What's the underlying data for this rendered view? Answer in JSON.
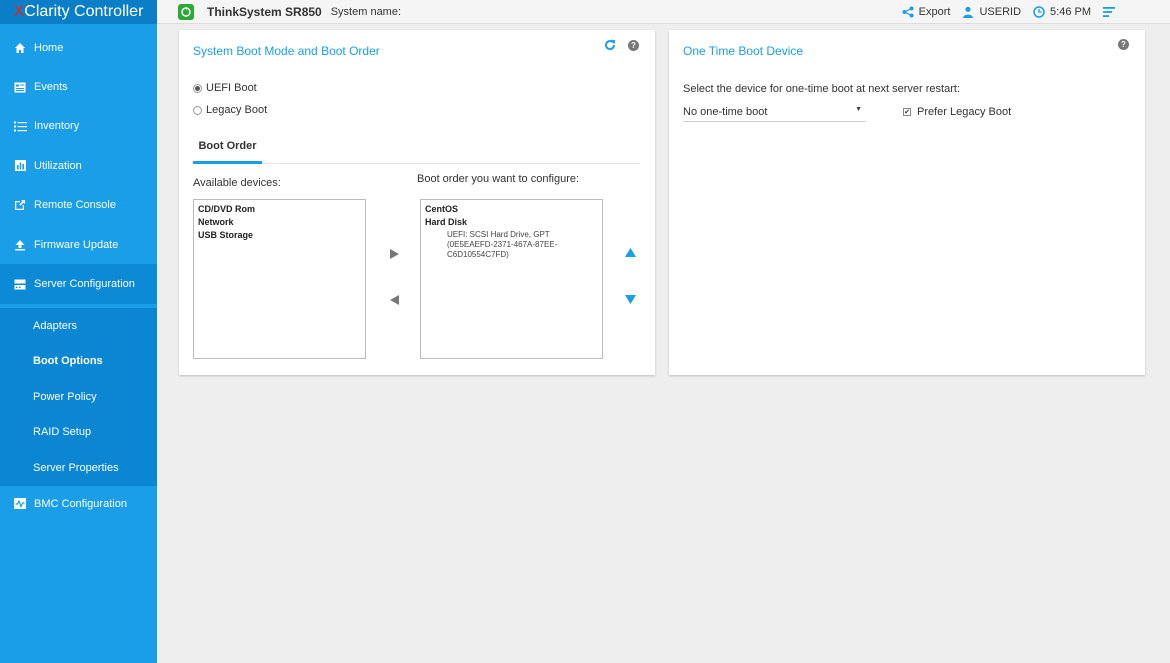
{
  "brand": {
    "prefix": "X",
    "suffix": "Clarity Controller"
  },
  "header": {
    "model": "ThinkSystem SR850",
    "system_name_label": "System name:",
    "export_label": "Export",
    "user": "USERID",
    "time": "5:46 PM"
  },
  "sidebar": {
    "items": [
      {
        "label": "Home",
        "icon": "home-icon"
      },
      {
        "label": "Events",
        "icon": "events-icon"
      },
      {
        "label": "Inventory",
        "icon": "list-icon"
      },
      {
        "label": "Utilization",
        "icon": "bar-chart-icon"
      },
      {
        "label": "Remote Console",
        "icon": "external-window-icon"
      },
      {
        "label": "Firmware Update",
        "icon": "upload-icon"
      },
      {
        "label": "Server Configuration",
        "icon": "server-icon"
      },
      {
        "label": "BMC Configuration",
        "icon": "bmc-icon"
      }
    ],
    "sub_items": [
      {
        "label": "Adapters"
      },
      {
        "label": "Boot Options",
        "selected": true
      },
      {
        "label": "Power Policy"
      },
      {
        "label": "RAID Setup"
      },
      {
        "label": "Server Properties"
      }
    ]
  },
  "boot_card": {
    "title": "System Boot Mode and Boot Order",
    "modes": [
      {
        "label": "UEFI Boot",
        "selected": true
      },
      {
        "label": "Legacy Boot",
        "selected": false
      }
    ],
    "tab_label": "Boot Order",
    "available_label": "Available devices:",
    "available_devices": [
      "CD/DVD Rom",
      "Network",
      "USB Storage"
    ],
    "configured_label": "Boot order you want to configure:",
    "configured": {
      "items": [
        "CentOS",
        "Hard Disk"
      ],
      "detail_line1": "UEFI: SCSI Hard Drive, GPT",
      "detail_line2": "(0E5EAEFD-2371-467A-87EE-",
      "detail_line3": "C6D10554C7FD)"
    }
  },
  "one_time_card": {
    "title": "One Time Boot Device",
    "prompt": "Select the device for one-time boot at next server restart:",
    "selected_value": "No one-time boot",
    "prefer_legacy_label": "Prefer Legacy Boot",
    "prefer_legacy_checked": true
  },
  "colors": {
    "accent": "#1a9ee8",
    "sidebar": "#1a9ee8",
    "brand_bar": "#0a7fc7",
    "brand_x": "#e8232a",
    "logo": "#2ea836"
  }
}
